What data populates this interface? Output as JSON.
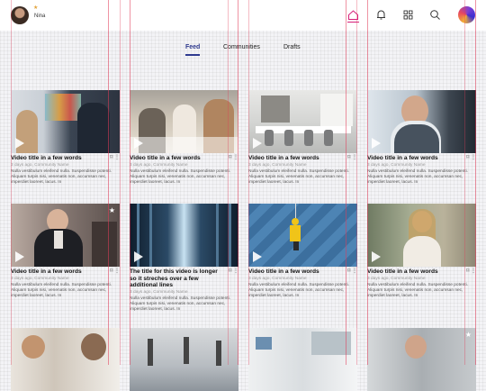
{
  "user": {
    "name": "Nina"
  },
  "nav": {
    "tabs": [
      {
        "label": "Feed"
      },
      {
        "label": "Communities"
      },
      {
        "label": "Drafts"
      }
    ]
  },
  "cards": [
    {
      "title": "Video title in a few words",
      "meta": "3 days ago, Community Name",
      "desc": "Nulla vestibulum eleifend nulla. Suspendisse potenti. Aliquam turpis nisi, venenatis non, accumsan nec, imperdiet laoreet, lacus. In"
    },
    {
      "title": "Video title in a few words",
      "meta": "3 days ago, Community Name",
      "desc": "Nulla vestibulum eleifend nulla. Suspendisse potenti. Aliquam turpis nisi, venenatis non, accumsan nec, imperdiet laoreet, lacus. In"
    },
    {
      "title": "Video title in a few words",
      "meta": "3 days ago, Community Name",
      "desc": "Nulla vestibulum eleifend nulla. Suspendisse potenti. Aliquam turpis nisi, venenatis non, accumsan nec, imperdiet laoreet, lacus. In"
    },
    {
      "title": "Video title in a few words",
      "meta": "3 days ago, Community Name",
      "desc": "Nulla vestibulum eleifend nulla. Suspendisse potenti. Aliquam turpis nisi, venenatis non, accumsan nec, imperdiet laoreet, lacus. In"
    },
    {
      "title": "Video title in a few words",
      "meta": "3 days ago, Community Name",
      "desc": "Nulla vestibulum eleifend nulla. Suspendisse potenti. Aliquam turpis nisi, venenatis non, accumsan nec, imperdiet laoreet, lacus. In"
    },
    {
      "title": "The title for this video is longer so it streches over a few additional lines",
      "meta": "3 days ago, Community Name",
      "desc": "Nulla vestibulum eleifend nulla. Suspendisse potenti. Aliquam turpis nisi, venenatis non, accumsan nec, imperdiet laoreet, lacus. In"
    },
    {
      "title": "Video title in a few words",
      "meta": "3 days ago, Community Name",
      "desc": "Nulla vestibulum eleifend nulla. Suspendisse potenti. Aliquam turpis nisi, venenatis non, accumsan nec, imperdiet laoreet, lacus. In"
    },
    {
      "title": "Video title in a few words",
      "meta": "3 days ago, Community Name",
      "desc": "Nulla vestibulum eleifend nulla. Suspendisse potenti. Aliquam turpis nisi, venenatis non, accumsan nec, imperdiet laoreet, lacus. In"
    }
  ],
  "icons": {
    "home": "home-icon",
    "notifications": "bell-icon",
    "apps": "grid-icon",
    "search": "search-icon",
    "bookmark": "bookmark-icon",
    "more": "more-vertical-icon",
    "play": "play-icon",
    "star": "star-icon"
  },
  "colors": {
    "accent": "#d61f79",
    "tab_active": "#2f3a8f"
  }
}
